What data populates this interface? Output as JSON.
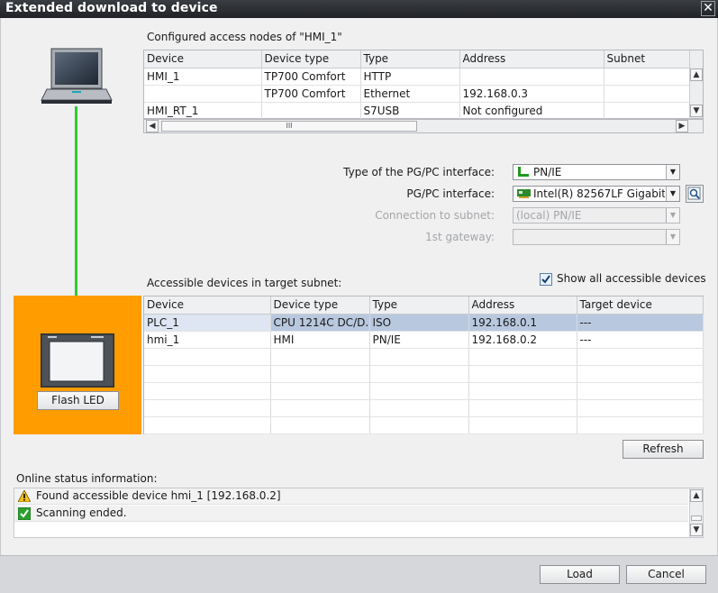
{
  "window": {
    "title": "Extended download to device",
    "close_glyph": "✕"
  },
  "configured": {
    "caption": "Configured access nodes of \"HMI_1\"",
    "columns": [
      "Device",
      "Device type",
      "Type",
      "Address",
      "Subnet"
    ],
    "rows": [
      [
        "HMI_1",
        "TP700 Comfort",
        "HTTP",
        "",
        ""
      ],
      [
        "",
        "TP700 Comfort",
        "Ethernet",
        "192.168.0.3",
        ""
      ],
      [
        "HMI_RT_1",
        "",
        "S7USB",
        "Not configured",
        ""
      ]
    ],
    "hscroll_thumb_glyph": "III"
  },
  "interface": {
    "type_label": "Type of the PG/PC interface:",
    "type_value": "PN/IE",
    "pgpc_label": "PG/PC interface:",
    "pgpc_value": "Intel(R) 82567LF Gigabit...",
    "subnet_label": "Connection to subnet:",
    "subnet_value": "(local) PN/IE",
    "gateway_label": "1st gateway:",
    "gateway_value": ""
  },
  "accessible": {
    "caption": "Accessible devices in target subnet:",
    "show_all_label": "Show all accessible devices",
    "show_all_checked": true,
    "columns": [
      "Device",
      "Device type",
      "Type",
      "Address",
      "Target device"
    ],
    "rows": [
      [
        "PLC_1",
        "CPU 1214C DC/D...",
        "ISO",
        "192.168.0.1",
        "---"
      ],
      [
        "hmi_1",
        "HMI",
        "PN/IE",
        "192.168.0.2",
        "---"
      ]
    ],
    "selected_row": 0,
    "flash_led_label": "Flash LED",
    "refresh_label": "Refresh"
  },
  "online_status": {
    "caption": "Online status information:",
    "messages": [
      {
        "icon": "warning-icon",
        "text": "Found accessible device hmi_1 [192.168.0.2]"
      },
      {
        "icon": "check-icon",
        "text": "Scanning ended."
      }
    ]
  },
  "footer": {
    "load_label": "Load",
    "cancel_label": "Cancel"
  },
  "colors": {
    "accent_orange": "#ff9c00",
    "link_green": "#2ecc2e",
    "selection": "#b8c8df",
    "title_bar": "#2a2c30"
  }
}
